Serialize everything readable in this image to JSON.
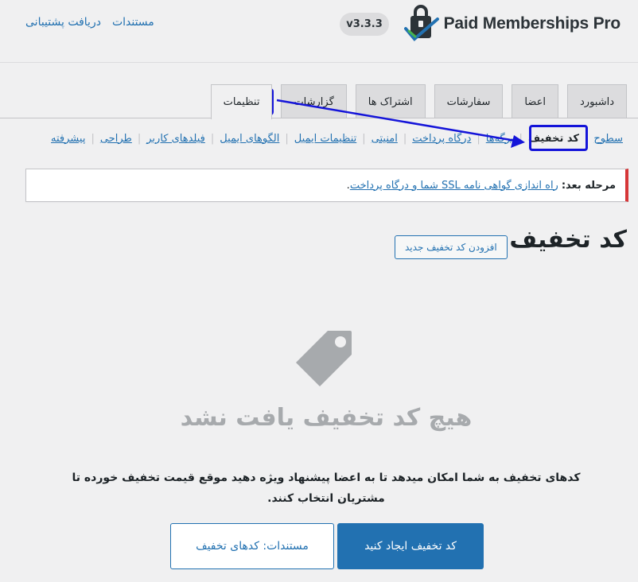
{
  "header": {
    "brand_name": "Paid Memberships Pro",
    "version": "v3.3.3",
    "links": [
      {
        "label": "مستندات"
      },
      {
        "label": "دریافت پشتیبانی"
      }
    ]
  },
  "tabs": [
    {
      "label": "داشبورد",
      "active": false
    },
    {
      "label": "اعضا",
      "active": false
    },
    {
      "label": "سفارشات",
      "active": false
    },
    {
      "label": "اشتراک ها",
      "active": false
    },
    {
      "label": "گزارشات",
      "active": false
    },
    {
      "label": "تنظیمات",
      "active": true
    }
  ],
  "subnav": [
    {
      "label": "سطوح",
      "current": false
    },
    {
      "label": "کد تخفیف",
      "current": true
    },
    {
      "label": "برگه‌ها",
      "current": false
    },
    {
      "label": "درگاه پرداخت",
      "current": false
    },
    {
      "label": "امنیتی",
      "current": false
    },
    {
      "label": "تنظیمات ایمیل",
      "current": false
    },
    {
      "label": "الگوهای ایمیل",
      "current": false
    },
    {
      "label": "فیلدهای کاربر",
      "current": false
    },
    {
      "label": "طراحی",
      "current": false
    },
    {
      "label": "پیشرفته",
      "current": false
    }
  ],
  "notice": {
    "prefix": "مرحله بعد:",
    "link": "راه اندازی گواهی نامه SSL شما و درگاه پرداخت",
    "suffix": "."
  },
  "page": {
    "title": "کد تخفیف",
    "add_new_label": "افزودن کد تخفیف جدید"
  },
  "empty_state": {
    "icon": "tag-icon",
    "title": "هیچ کد تخفیف یافت نشد",
    "description": "کدهای تخفیف به شما امکان میدهد تا به اعضا پیشنهاد ویژه دهید موقع قیمت تخفیف خورده تا مشتریان انتخاب کنند.",
    "primary_button": "کد تخفیف ایجاد کنید",
    "secondary_button": "مستندات: کدهای تخفیف"
  },
  "colors": {
    "accent": "#2271b1",
    "notice_border": "#d63638",
    "annotation": "#1414d9"
  }
}
